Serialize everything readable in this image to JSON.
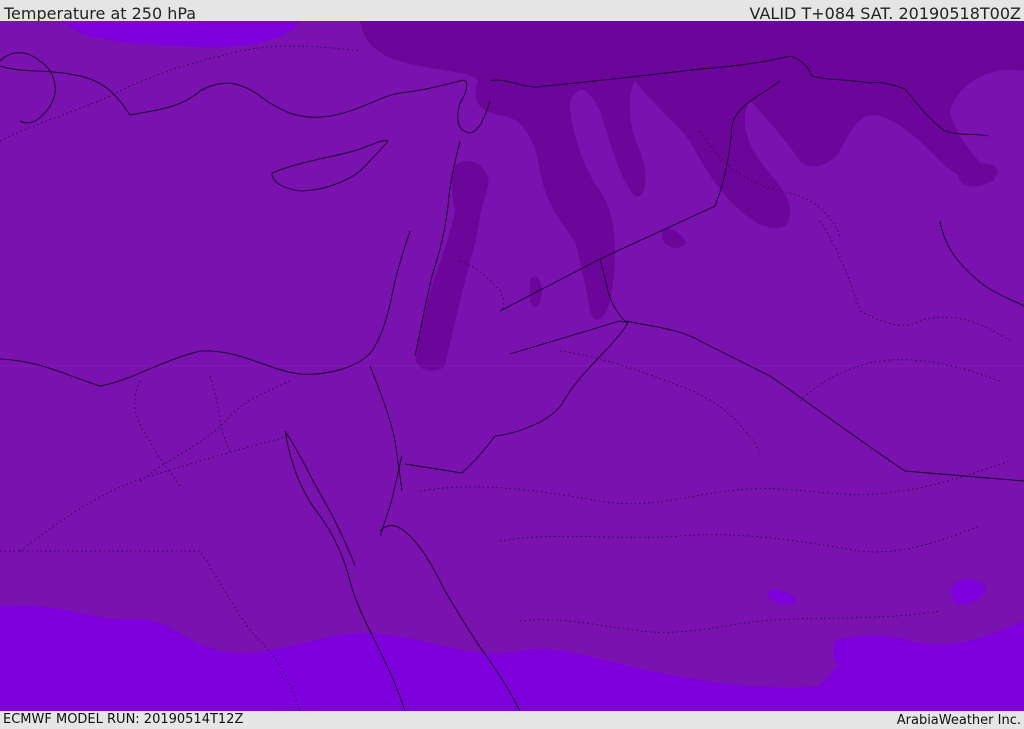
{
  "header": {
    "title": "Temperature at 250 hPa",
    "valid": "VALID T+084 SAT. 20190518T00Z"
  },
  "footer": {
    "model_run": "ECMWF MODEL RUN: 20190514T12Z",
    "credit": "ArabiaWeather Inc."
  },
  "map": {
    "fill_colors": {
      "base": "#7a12b0",
      "cold": "#6c0599",
      "warm": "#7e00dc"
    }
  }
}
